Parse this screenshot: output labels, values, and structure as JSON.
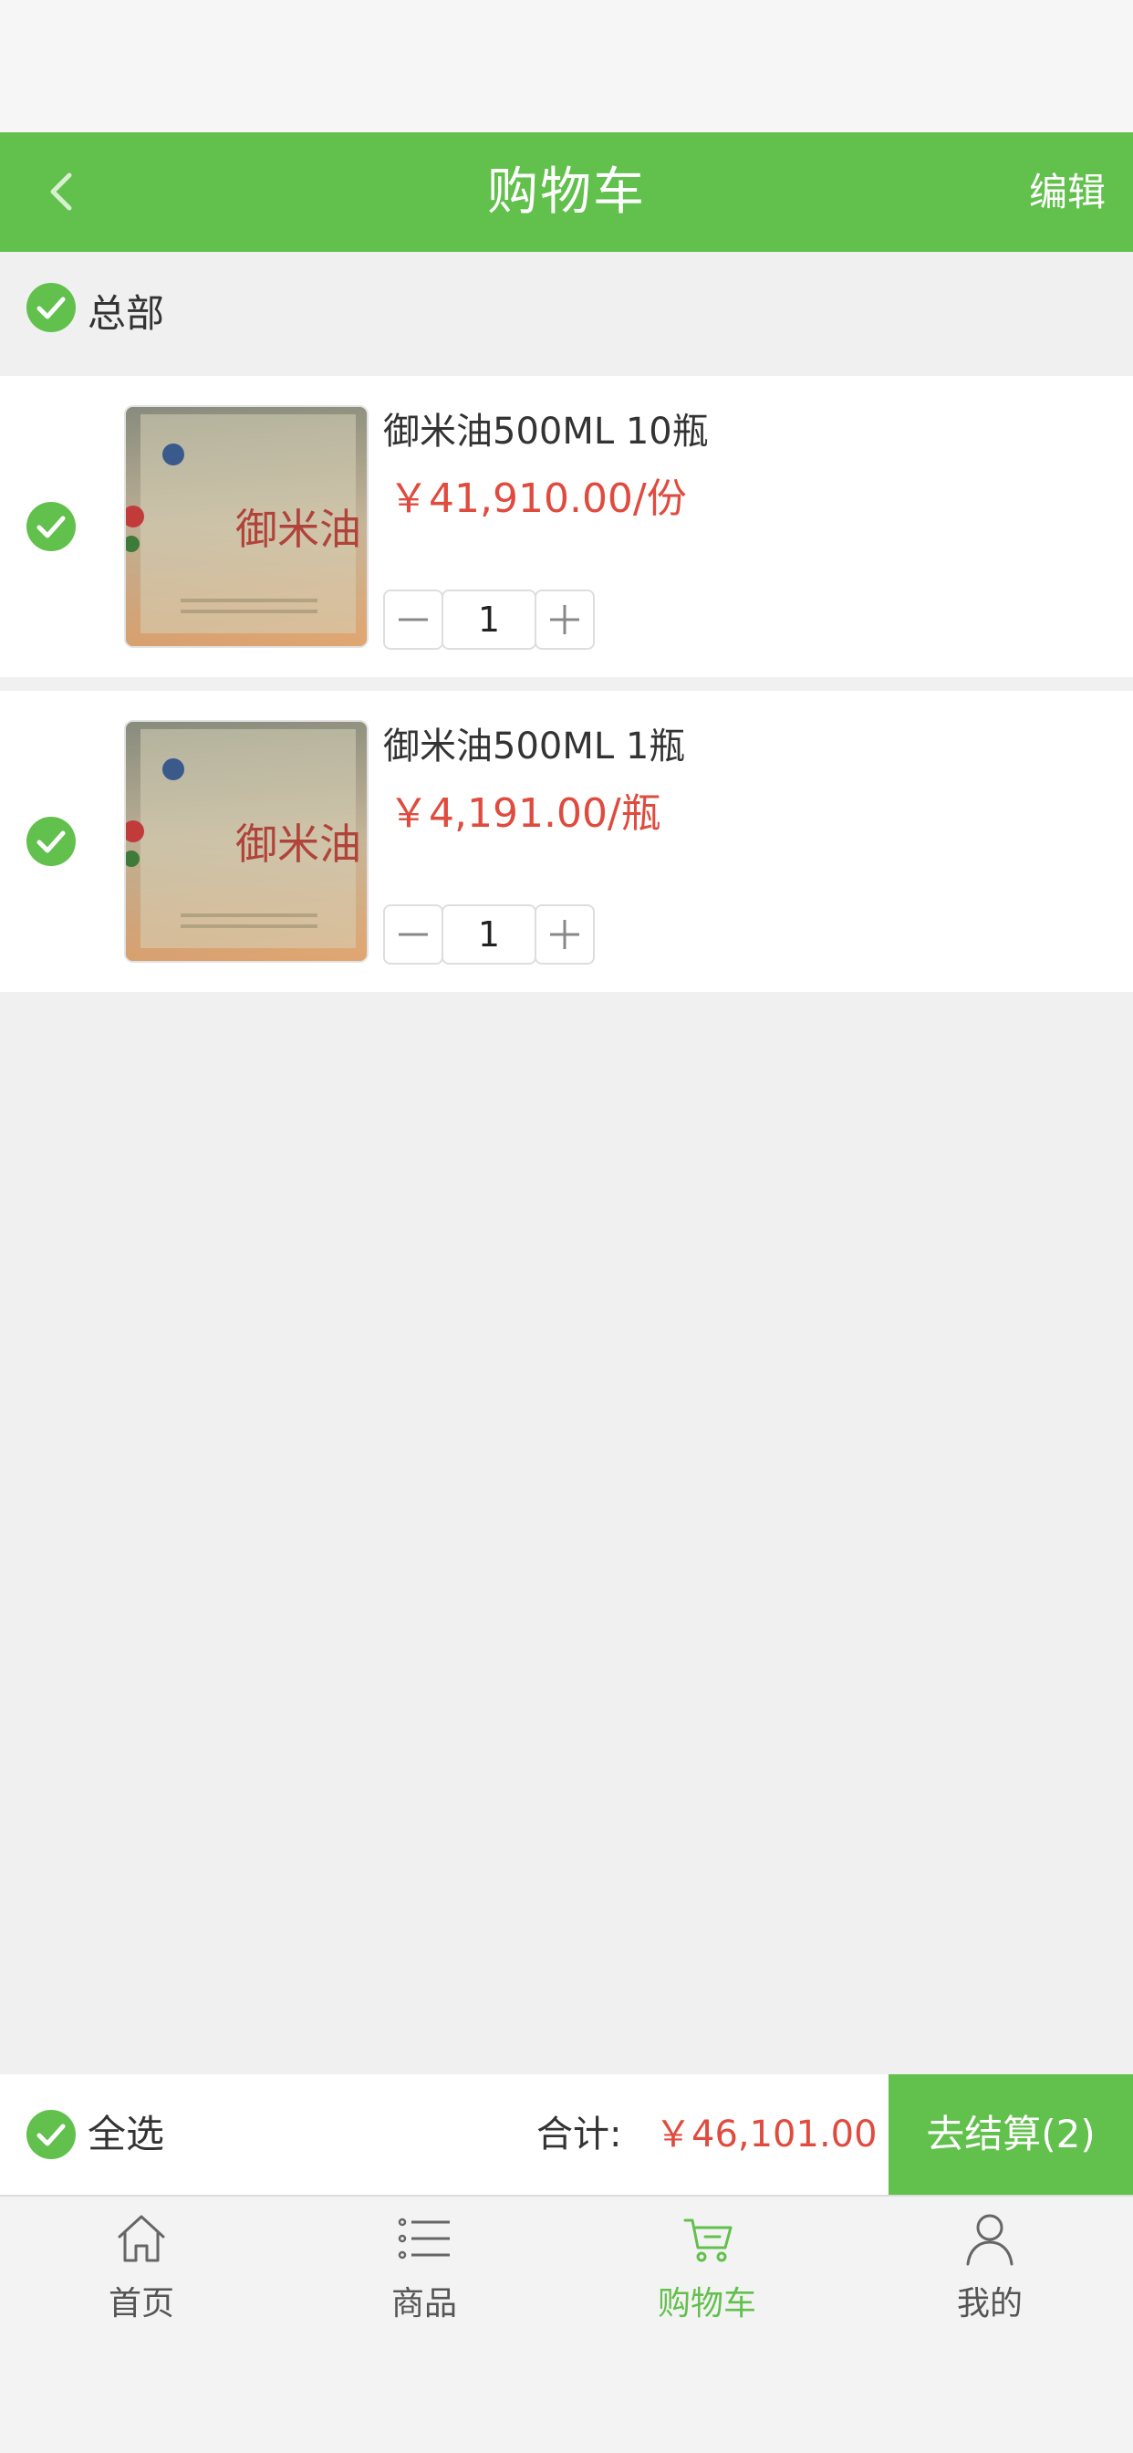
{
  "header": {
    "title": "购物车",
    "edit_label": "编辑"
  },
  "store": {
    "name": "总部",
    "checked": true
  },
  "items": [
    {
      "title": "御米油500ML 10瓶",
      "price": "￥41,910.00/份",
      "quantity": "1",
      "checked": true,
      "image_alt": "御米油"
    },
    {
      "title": "御米油500ML 1瓶",
      "price": "￥4,191.00/瓶",
      "quantity": "1",
      "checked": true,
      "image_alt": "御米油"
    }
  ],
  "checkout": {
    "select_all_label": "全选",
    "total_label": "合计:",
    "total_value": "￥46,101.00",
    "button_label": "去结算(2)"
  },
  "tabs": [
    {
      "label": "首页",
      "icon": "home-icon"
    },
    {
      "label": "商品",
      "icon": "list-icon"
    },
    {
      "label": "购物车",
      "icon": "cart-icon",
      "active": true
    },
    {
      "label": "我的",
      "icon": "user-icon"
    }
  ],
  "colors": {
    "brand_green": "#62c04d",
    "price_red": "#e04b3f"
  }
}
